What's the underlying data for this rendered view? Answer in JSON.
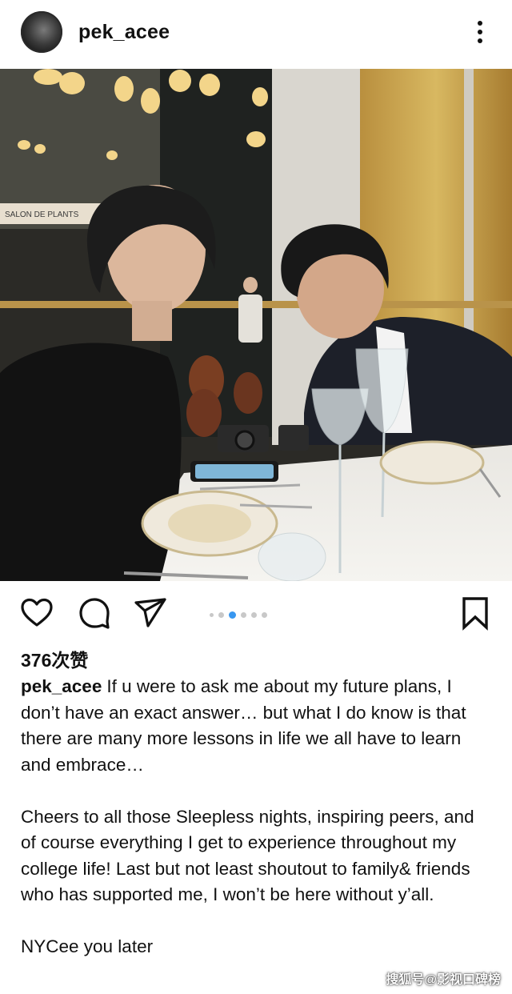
{
  "header": {
    "username": "pek_acee",
    "more_icon": "more-vertical-icon"
  },
  "photo": {
    "sign_text": "SALON DE PLANTS",
    "carousel": {
      "count": 6,
      "active_index": 2
    }
  },
  "actions": {
    "like_icon": "heart-icon",
    "comment_icon": "comment-icon",
    "share_icon": "send-icon",
    "save_icon": "bookmark-icon"
  },
  "likes_text": "376次赞",
  "caption": {
    "username": "pek_acee",
    "paragraph1": "If u were to ask me about my future plans, I don’t have an exact answer… but what I do know is that there are many more lessons in life we all have to learn and embrace…",
    "paragraph2": "Cheers to all those Sleepless nights, inspiring peers, and of course everything I get to experience throughout my college life!  Last but not least shoutout to family& friends who has supported me, I won’t be here without y’all.",
    "paragraph3": "NYCee you later"
  },
  "watermark": "搜狐号@影视口碑榜",
  "colors": {
    "carousel_active": "#3897f0",
    "text": "#111111"
  }
}
